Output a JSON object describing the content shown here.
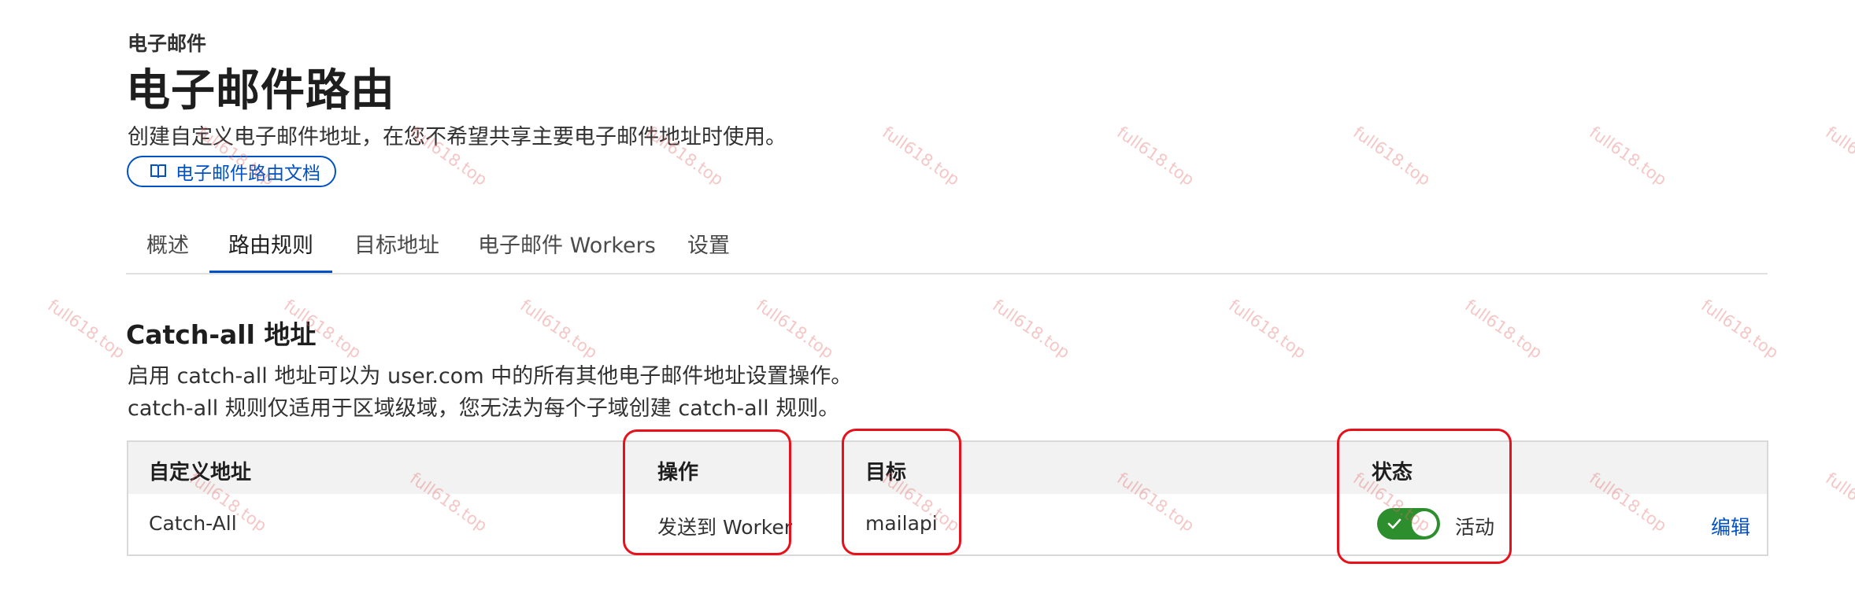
{
  "header": {
    "eyebrow": "电子邮件",
    "title": "电子邮件路由",
    "subtitle": "创建自定义电子邮件地址，在您不希望共享主要电子邮件地址时使用。",
    "docs_link": "电子邮件路由文档"
  },
  "tabs": [
    {
      "label": "概述"
    },
    {
      "label": "路由规则",
      "active": true
    },
    {
      "label": "目标地址"
    },
    {
      "label": "电子邮件 Workers"
    },
    {
      "label": "设置"
    }
  ],
  "catch_all": {
    "title": "Catch-all 地址",
    "description_line1": "启用 catch-all 地址可以为 user.com 中的所有其他电子邮件地址设置操作。",
    "description_line2": "catch-all 规则仅适用于区域级域，您无法为每个子域创建 catch-all 规则。"
  },
  "table": {
    "headers": {
      "custom_address": "自定义地址",
      "action": "操作",
      "destination": "目标",
      "status": "状态"
    },
    "row": {
      "custom_address": "Catch-All",
      "action": "发送到 Worker",
      "destination": "mailapi",
      "status_enabled": true,
      "status_label": "活动",
      "edit_label": "编辑"
    }
  },
  "watermark": "full618.top",
  "colors": {
    "accent": "#0051c3",
    "toggle_on": "#2d8e2d",
    "highlight": "#e8101a"
  }
}
